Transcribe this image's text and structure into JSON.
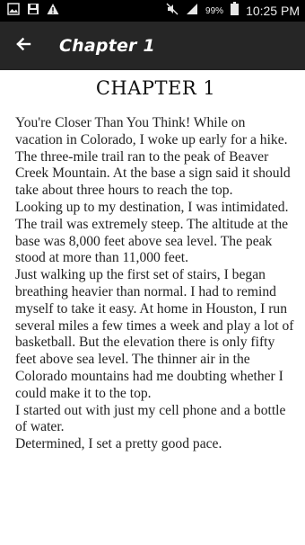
{
  "status_bar": {
    "time": "10:25 PM",
    "battery_percent": "99%",
    "icons": [
      "image-icon",
      "save-icon",
      "warning-icon",
      "mute-icon",
      "signal-icon",
      "battery-icon"
    ]
  },
  "app_bar": {
    "title": "Chapter 1",
    "back_icon": "arrow-left-icon"
  },
  "content": {
    "heading": "CHAPTER 1",
    "paragraphs": [
      "You're Closer Than You Think! While on vacation in Colorado, I woke up early for a hike.",
      " The three-mile trail ran to the peak of Beaver Creek Mountain. At the base a sign said it should take about three hours to reach the top.",
      " Looking up to my destination, I was intimidated. The trail was extremely steep. The altitude at the base was 8,000 feet above sea level. The peak stood at more than 11,000 feet.",
      " Just walking up the first set of stairs, I began breathing heavier than normal. I had to remind myself to take it easy. At home in Houston, I run several miles a few times a week and play a lot of basketball. But the elevation there is only fifty feet above sea level. The thinner air in the Colorado mountains had me doubting whether I could make it to the top.",
      " I started out with just my cell phone and a bottle of water.",
      " Determined, I set a pretty good pace."
    ]
  },
  "colors": {
    "status_bar": "#000000",
    "app_bar": "#262626",
    "page": "#ffffff",
    "text": "#222222"
  }
}
